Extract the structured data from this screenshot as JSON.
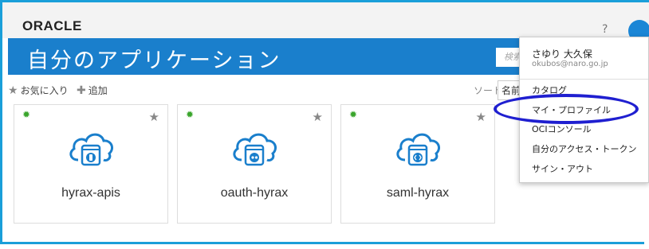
{
  "header": {
    "logo": "ORACLE",
    "help_icon": "?"
  },
  "banner": {
    "title": "自分のアプリケーション",
    "search_placeholder": "検索"
  },
  "toolbar": {
    "favorites_label": "お気に入り",
    "add_label": "追加",
    "sort_label": "ソート",
    "sort_value": "名前"
  },
  "apps": [
    {
      "name": "hyrax-apis",
      "status": "active",
      "icon": "mobile-app-icon"
    },
    {
      "name": "oauth-hyrax",
      "status": "active",
      "icon": "oauth-app-icon"
    },
    {
      "name": "saml-hyrax",
      "status": "active",
      "icon": "code-app-icon"
    }
  ],
  "user_menu": {
    "user_name": "さゆり 大久保",
    "user_email": "okubos@naro.go.jp",
    "items": [
      "カタログ",
      "マイ・プロファイル",
      "OCIコンソール",
      "自分のアクセス・トークン",
      "サイン・アウト"
    ]
  },
  "colors": {
    "brand": "#1a7fcc",
    "frame": "#1a9fd9",
    "highlight": "#1f1fd0",
    "status": "#3aa52c"
  }
}
